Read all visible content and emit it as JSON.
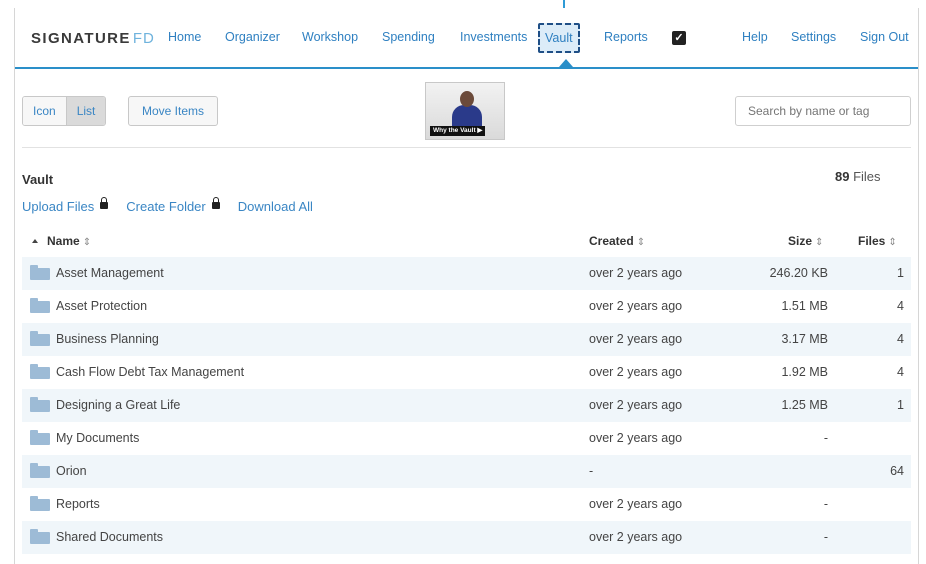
{
  "header": {
    "logo_main": "SIGNATURE",
    "logo_accent": "FD",
    "nav": [
      "Home",
      "Organizer",
      "Workshop",
      "Spending",
      "Investments",
      "Vault",
      "Reports"
    ],
    "active_nav": "Vault",
    "right_nav": [
      "Help",
      "Settings",
      "Sign Out"
    ]
  },
  "toolbar": {
    "view_icon": "Icon",
    "view_list": "List",
    "active_view": "List",
    "move_items": "Move Items",
    "video_caption": "Why the Vault ▶",
    "search_placeholder": "Search by name or tag"
  },
  "vault": {
    "title": "Vault",
    "file_count_number": "89",
    "file_count_label": "Files",
    "actions": {
      "upload": "Upload Files",
      "create_folder": "Create Folder",
      "download_all": "Download All"
    }
  },
  "table": {
    "columns": {
      "name": "Name",
      "created": "Created",
      "size": "Size",
      "files": "Files"
    },
    "sort_glyph": "⇕",
    "rows": [
      {
        "name": "Asset Management",
        "created": "over 2 years ago",
        "size": "246.20 KB",
        "files": "1"
      },
      {
        "name": "Asset Protection",
        "created": "over 2 years ago",
        "size": "1.51 MB",
        "files": "4"
      },
      {
        "name": "Business Planning",
        "created": "over 2 years ago",
        "size": "3.17 MB",
        "files": "4"
      },
      {
        "name": "Cash Flow Debt Tax Management",
        "created": "over 2 years ago",
        "size": "1.92 MB",
        "files": "4"
      },
      {
        "name": "Designing a Great Life",
        "created": "over 2 years ago",
        "size": "1.25 MB",
        "files": "1"
      },
      {
        "name": "My Documents",
        "created": "over 2 years ago",
        "size": "-",
        "files": ""
      },
      {
        "name": "Orion",
        "created": "-",
        "size": "",
        "files": "64"
      },
      {
        "name": "Reports",
        "created": "over 2 years ago",
        "size": "-",
        "files": ""
      },
      {
        "name": "Shared Documents",
        "created": "over 2 years ago",
        "size": "-",
        "files": ""
      }
    ]
  },
  "colors": {
    "accent": "#2a8fc9",
    "link": "#2f80c1",
    "active_highlight": "#dcecf8",
    "row_stripe": "#f0f6fa",
    "folder": "#9dbbd6"
  }
}
